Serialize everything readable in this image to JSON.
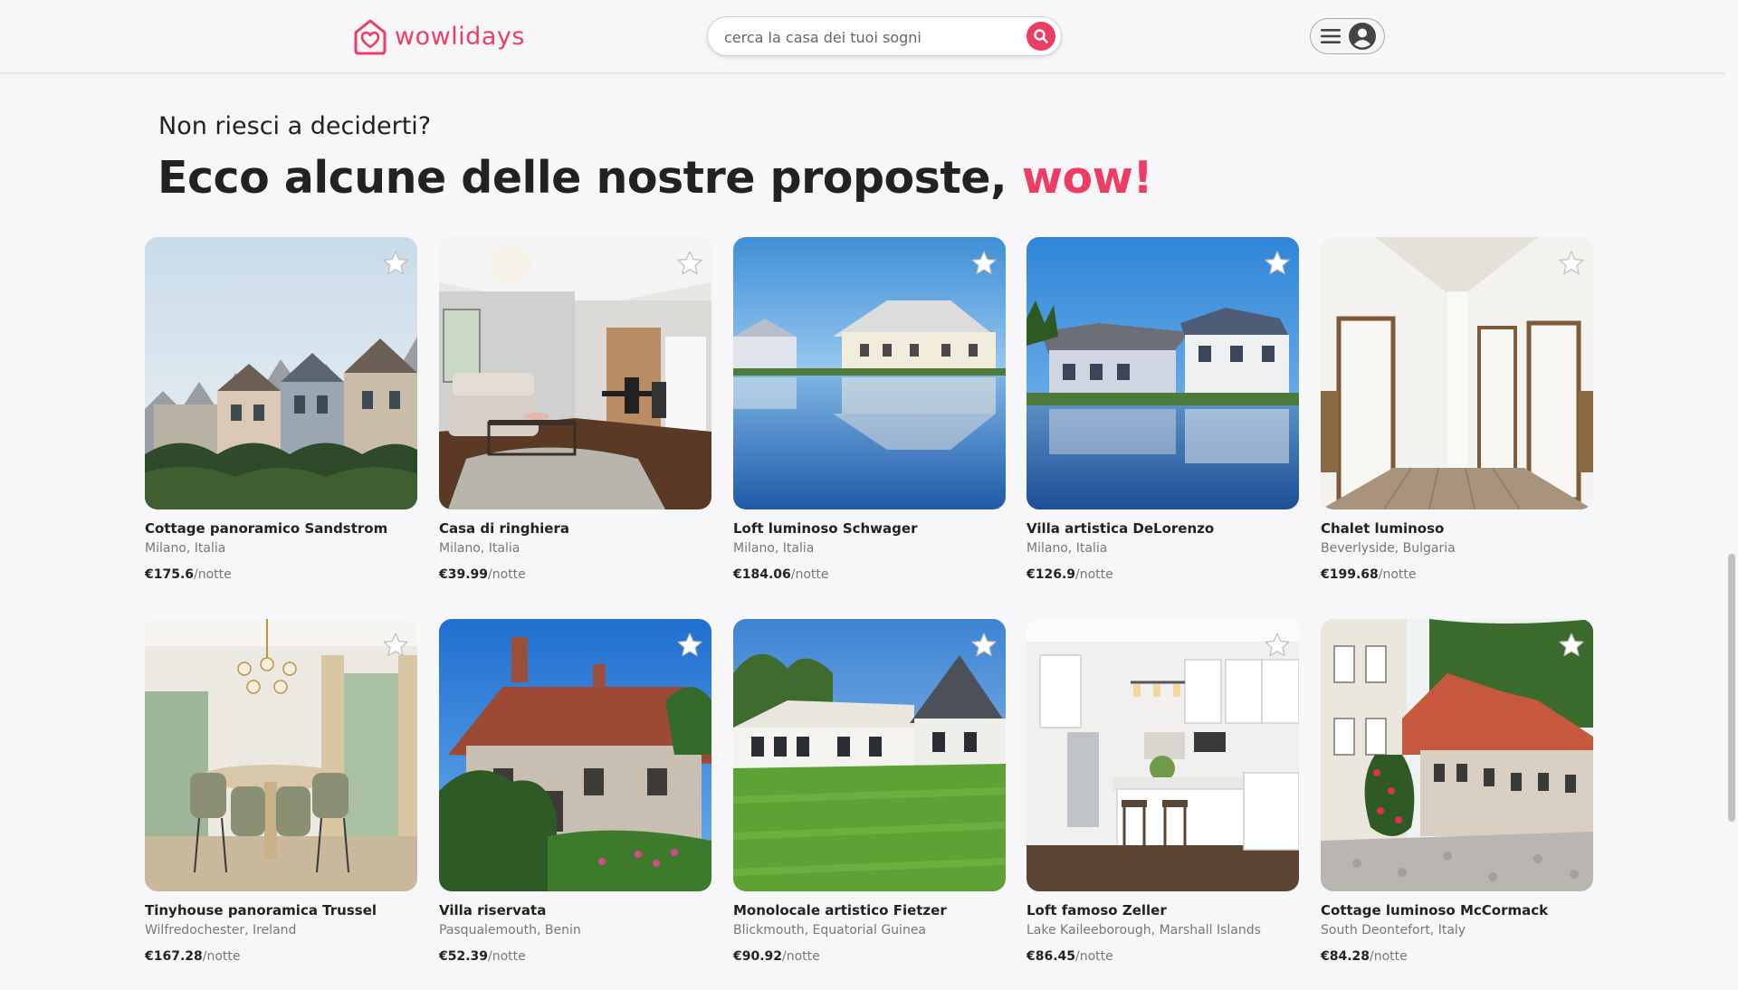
{
  "header": {
    "logo_text": "wowlidays",
    "search": {
      "placeholder": "cerca la casa dei tuoi sogni"
    }
  },
  "hero": {
    "subtitle": "Non riesci a deciderti?",
    "title": "Ecco alcune delle nostre proposte,",
    "title_accent": "wow!"
  },
  "colors": {
    "accent": "#ee3d64",
    "background": "#f7f7f9"
  },
  "listings": [
    {
      "name": "Cottage panoramico Sandstrom",
      "location": "Milano, Italia",
      "price": "€175.6",
      "unit": "/notte",
      "image": "victorian-townhouses"
    },
    {
      "name": "Casa di ringhiera",
      "location": "Milano, Italia",
      "price": "€39.99",
      "unit": "/notte",
      "image": "modern-living-room"
    },
    {
      "name": "Loft luminoso Schwager",
      "location": "Milano, Italia",
      "price": "€184.06",
      "unit": "/notte",
      "image": "lakeside-house-reflection"
    },
    {
      "name": "Villa artistica DeLorenzo",
      "location": "Milano, Italia",
      "price": "€126.9",
      "unit": "/notte",
      "image": "waterfront-villas"
    },
    {
      "name": "Chalet luminoso",
      "location": "Beverlyside, Bulgaria",
      "price": "€199.68",
      "unit": "/notte",
      "image": "attic-hallway-doors"
    },
    {
      "name": "Tinyhouse panoramica Trussel",
      "location": "Wilfredochester, Ireland",
      "price": "€167.28",
      "unit": "/notte",
      "image": "dining-room"
    },
    {
      "name": "Villa riservata",
      "location": "Pasqualemouth, Benin",
      "price": "€52.39",
      "unit": "/notte",
      "image": "brick-cottage"
    },
    {
      "name": "Monolocale artistico Fietzer",
      "location": "Blickmouth, Equatorial Guinea",
      "price": "€90.92",
      "unit": "/notte",
      "image": "house-with-lawn"
    },
    {
      "name": "Loft famoso Zeller",
      "location": "Lake Kaileeborough, Marshall Islands",
      "price": "€86.45",
      "unit": "/notte",
      "image": "white-kitchen"
    },
    {
      "name": "Cottage luminoso McCormack",
      "location": "South Deontefort, Italy",
      "price": "€84.28",
      "unit": "/notte",
      "image": "cobblestone-street"
    }
  ]
}
